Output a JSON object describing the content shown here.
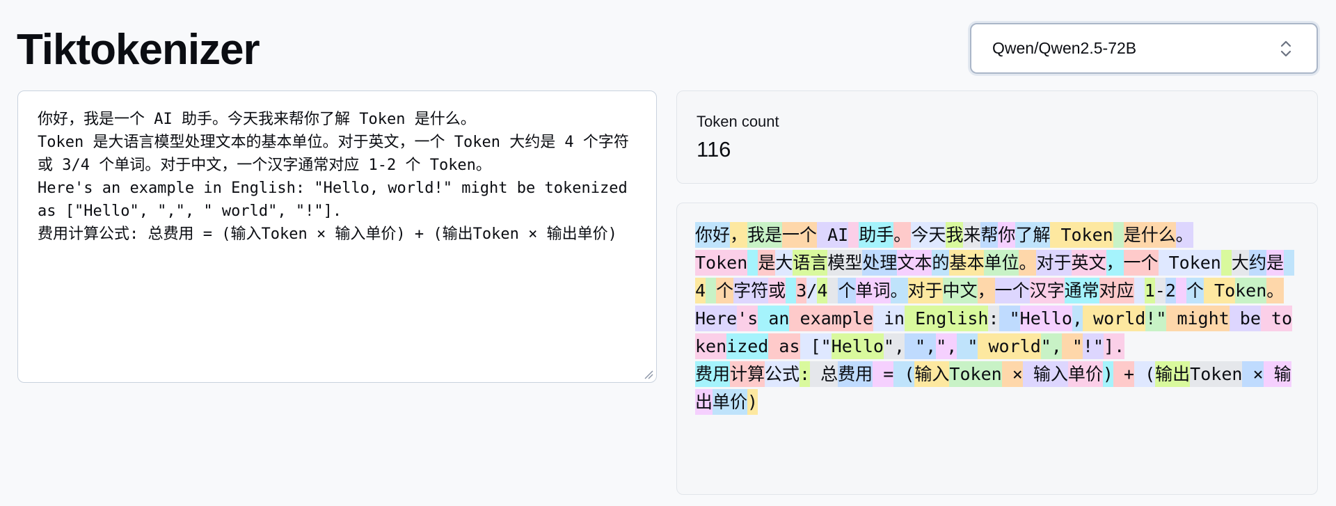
{
  "app": {
    "title": "Tiktokenizer"
  },
  "model_select": {
    "selected": "Qwen/Qwen2.5-72B",
    "icon": "chevron-up-down-icon"
  },
  "input": {
    "text": "你好，我是一个 AI 助手。今天我来帮你了解 Token 是什么。\nToken 是大语言模型处理文本的基本单位。对于英文，一个 Token 大约是 4 个字符或 3/4 个单词。对于中文，一个汉字通常对应 1-2 个 Token。\nHere's an example in English: \"Hello, world!\" might be tokenized as [\"Hello\", \",\", \" world\", \"!\"].\n费用计算公式: 总费用 = (输入Token × 输入单价) + (输出Token × 输出单价)"
  },
  "token_count": {
    "label": "Token count",
    "value": "116"
  },
  "colors": {
    "palette": [
      "#bfe3fb",
      "#fde8a0",
      "#c8f2c6",
      "#fed7aa",
      "#ddd6fe",
      "#fbcfe8",
      "#a5f3fc",
      "#fecaca",
      "#dfe8ff",
      "#d9f99d",
      "#e5e7eb",
      "#bfdbfe",
      "#f5d0fe"
    ]
  },
  "tokens": [
    "你好",
    "，",
    "我是",
    "一个",
    " AI",
    " ",
    "助手",
    "。",
    "今天",
    "我",
    "来",
    "帮",
    "你",
    "了解",
    " Token",
    " ",
    "是什么",
    "。",
    "\n",
    "Token",
    " ",
    "是",
    "大",
    "语言",
    "模型",
    "处理",
    "文本",
    "的",
    "基本",
    "单位",
    "。",
    "对于",
    "英文",
    "，",
    "一个",
    " Token",
    " ",
    "大",
    "约",
    "是",
    " ",
    "4",
    " ",
    "个",
    "字符",
    "或",
    " ",
    "3",
    "/",
    "4",
    " ",
    "个",
    "单词",
    "。",
    "对于",
    "中文",
    "，",
    "一个",
    "汉字",
    "通常",
    "对应",
    " ",
    "1",
    "-",
    "2",
    " ",
    "个",
    " To",
    "ken",
    "。",
    "\n",
    "Here",
    "'s",
    " an",
    " example",
    " in",
    " English",
    ":",
    " \"",
    "Hello",
    ",",
    " world",
    "!\"",
    " might",
    " be",
    " token",
    "ized",
    " as",
    " [\"",
    "Hello",
    "\",",
    " \",",
    "\",",
    " \"",
    " world",
    "\",",
    " \"",
    "!\"",
    "].",
    "\n",
    "费用",
    "计算",
    "公式",
    ":",
    " 总",
    "费用",
    " =",
    " (",
    "输入",
    "Token",
    " ×",
    " 输入",
    "单价",
    ")",
    " +",
    " (",
    "输出",
    "Token",
    " ×",
    " 输出",
    "单价",
    ")"
  ]
}
